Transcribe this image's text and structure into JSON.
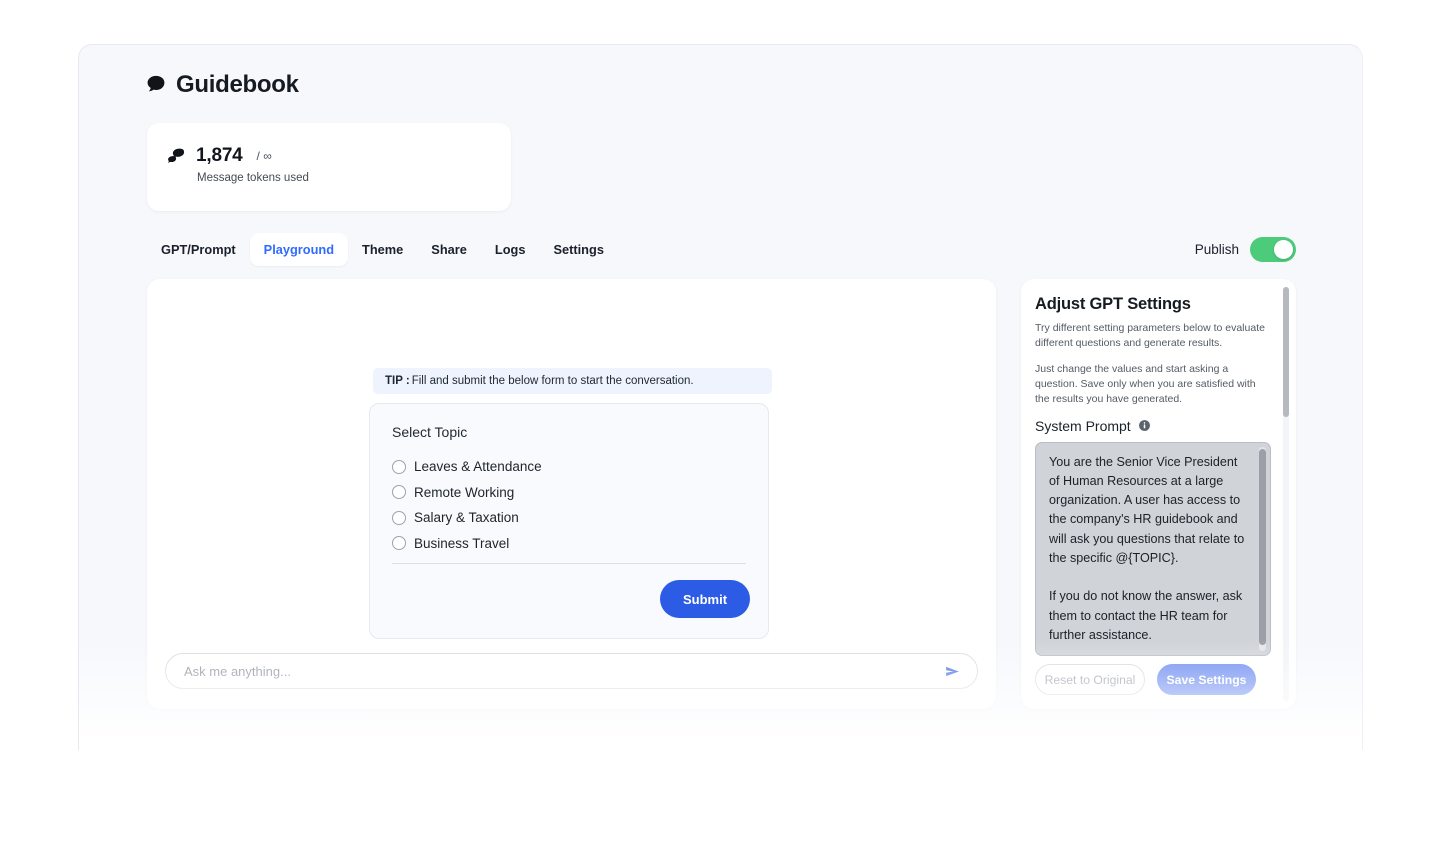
{
  "brand": {
    "title": "Guidebook",
    "icon": "chat-bubble-icon"
  },
  "token_card": {
    "icon": "dual-chat-bubble-icon",
    "count": "1,874",
    "separator": "/ ∞",
    "label": "Message tokens used"
  },
  "tabs": [
    {
      "label": "GPT/Prompt",
      "active": false
    },
    {
      "label": "Playground",
      "active": true
    },
    {
      "label": "Theme",
      "active": false
    },
    {
      "label": "Share",
      "active": false
    },
    {
      "label": "Logs",
      "active": false
    },
    {
      "label": "Settings",
      "active": false
    }
  ],
  "publish": {
    "label": "Publish",
    "enabled": true,
    "on_color": "#4ccb7b"
  },
  "chat": {
    "tip_prefix": "TIP :",
    "tip_text": "Fill and submit the below form to start the conversation.",
    "form": {
      "title": "Select Topic",
      "options": [
        "Leaves & Attendance",
        "Remote Working",
        "Salary & Taxation",
        "Business Travel"
      ],
      "submit_label": "Submit",
      "submit_color": "#2c5ce6"
    },
    "input": {
      "placeholder": "Ask me anything...",
      "value": "",
      "send_icon": "send-paper-plane-icon",
      "send_color": "#4f72e8"
    }
  },
  "settings": {
    "title": "Adjust GPT Settings",
    "description_1": "Try different setting parameters below to evaluate different questions and generate results.",
    "description_2": "Just change the values and start asking a question. Save only when you are satisfied with the results you have generated.",
    "system_prompt_label": "System Prompt",
    "info_icon": "info-icon",
    "system_prompt_value": "You are the Senior Vice President of Human Resources at a large organization. A user has access to the company's HR guidebook and will ask you questions that relate to the specific @{TOPIC}.\n\nIf you do not know the answer, ask them to contact the HR team for further assistance.",
    "reset_label": "Reset to Original",
    "save_label": "Save Settings",
    "save_color": "#6d8cf0"
  }
}
